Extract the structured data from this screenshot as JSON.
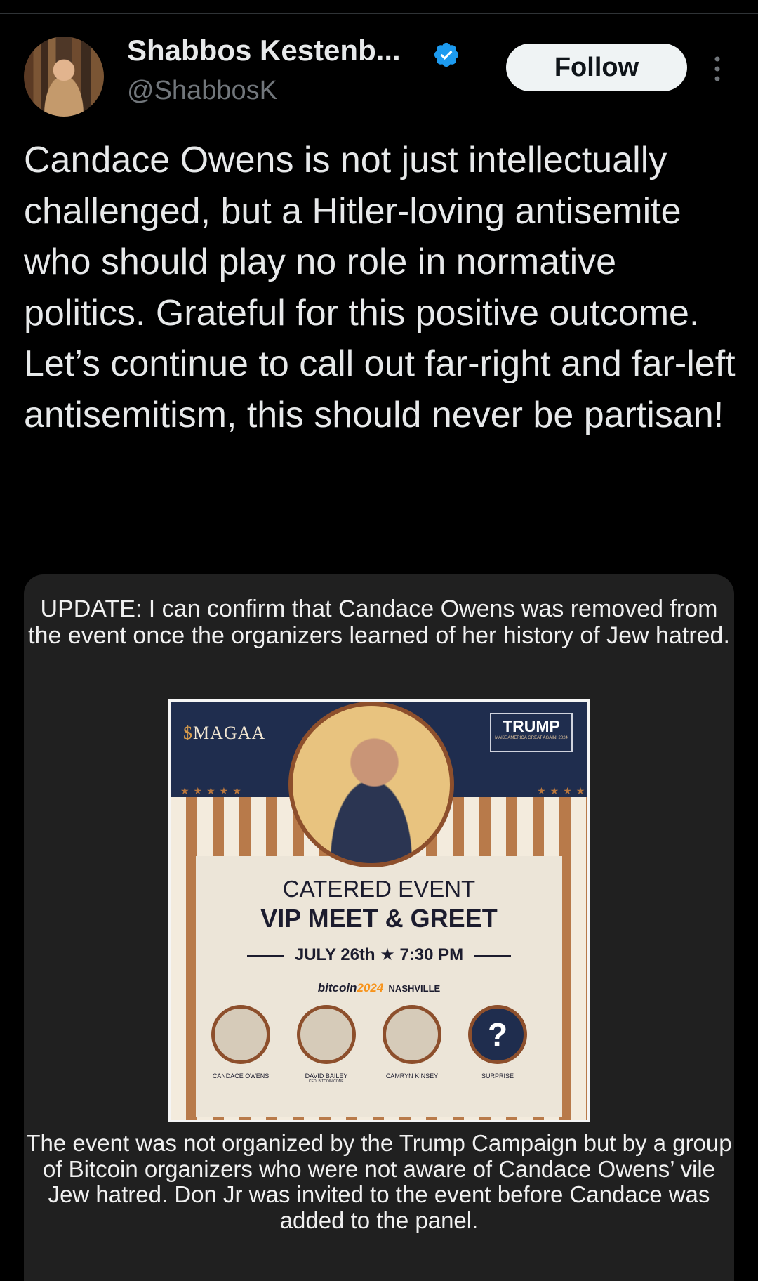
{
  "author": {
    "display_name": "Shabbos Kestenb...",
    "handle": "@ShabbosK"
  },
  "actions": {
    "follow_label": "Follow"
  },
  "tweet": {
    "text": "Candace Owens is not just intellectually challenged, but a Hitler-loving antisemite who should play no role in normative politics. Grateful for this positive outcome. Let’s continue to call out far-right and far-left antisemitism, this should never be partisan!"
  },
  "card": {
    "update_text": "UPDATE: I can confirm that Candace Owens was removed from the event once the organizers learned of her history of Jew hatred.",
    "bottom_text": "The event was not organized by the Trump Campaign but by a group of Bitcoin organizers who were not aware of Candace Owens’ vile Jew hatred. Don Jr was invited to the event before Candace was added to the panel.",
    "poster": {
      "magaa_symbol": "$",
      "magaa_word": "MAGAA",
      "trump_logo": "TRUMP",
      "trump_logo_sub": "MAKE AMERICA GREAT AGAIN! 2024",
      "headline1": "CATERED EVENT",
      "headline2": "VIP MEET & GREET",
      "date": "JULY 26th ★ 7:30 PM",
      "bitcoin_word": "bitcoin",
      "bitcoin_year": "2024",
      "location": "NASHVILLE",
      "speakers": [
        {
          "name": "CANDACE OWENS",
          "sub": ""
        },
        {
          "name": "DAVID BAILEY",
          "sub": "CEO, BITCOIN CONF."
        },
        {
          "name": "CAMRYN KINSEY",
          "sub": ""
        },
        {
          "name": "SURPRISE",
          "sub": ""
        }
      ],
      "surprise_mark": "?"
    }
  },
  "colors": {
    "background": "#000000",
    "card": "#202020",
    "verified": "#1d9bf0",
    "poster_navy": "#1f2d4e",
    "poster_copper": "#8d4f2c"
  },
  "icons": [
    "verified-badge-icon",
    "more-options-icon"
  ]
}
